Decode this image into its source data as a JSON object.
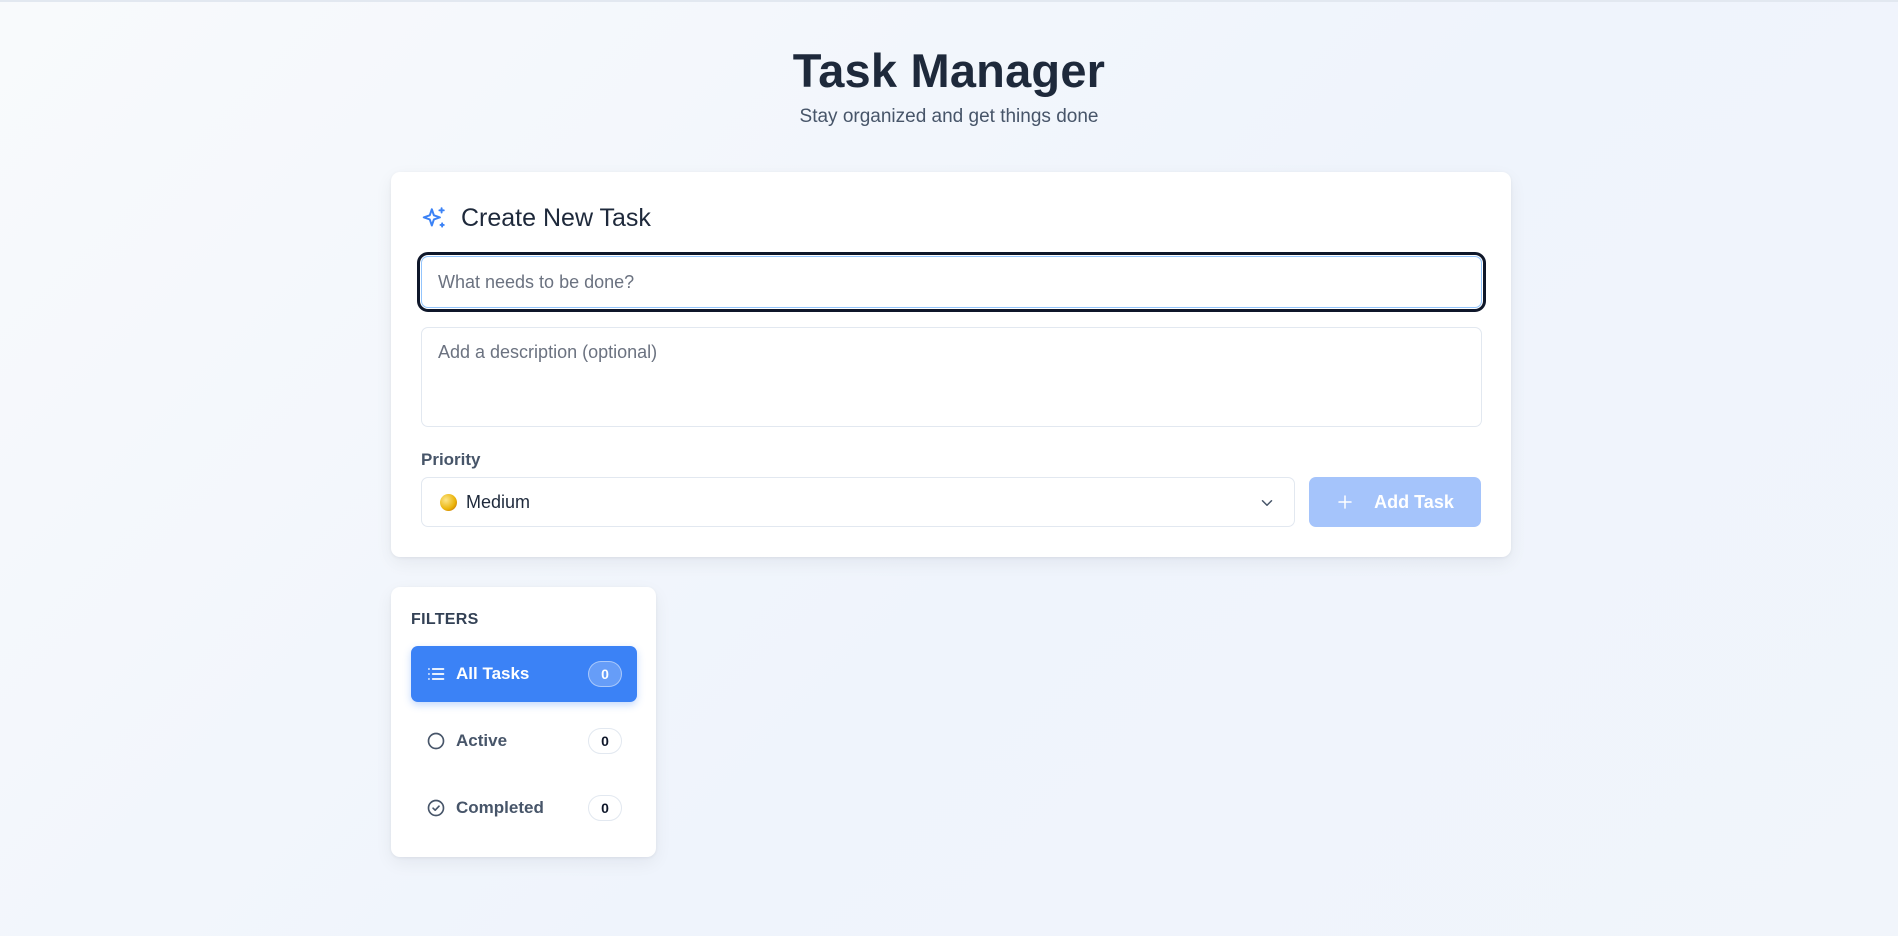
{
  "header": {
    "title": "Task Manager",
    "subtitle": "Stay organized and get things done"
  },
  "create_task": {
    "heading": "Create New Task",
    "heading_icon": "sparkles-icon",
    "title_placeholder": "What needs to be done?",
    "description_placeholder": "Add a description (optional)",
    "priority_label": "Priority",
    "priority_value": "Medium",
    "add_button_label": "Add Task"
  },
  "filters": {
    "heading": "FILTERS",
    "items": [
      {
        "label": "All Tasks",
        "count": "0",
        "icon": "list-icon",
        "selected": true
      },
      {
        "label": "Active",
        "count": "0",
        "icon": "circle-icon",
        "selected": false
      },
      {
        "label": "Completed",
        "count": "0",
        "icon": "check-circle-icon",
        "selected": false
      }
    ]
  },
  "colors": {
    "accent": "#3b82f6",
    "add_button_disabled": "#a5c4fb",
    "text_dark": "#1e293b",
    "text_muted": "#475569"
  }
}
